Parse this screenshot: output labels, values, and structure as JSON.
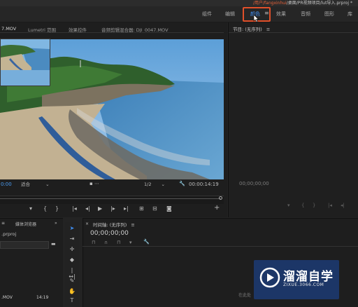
{
  "window": {
    "title_accent": "/用户/fangxinhui",
    "title_rest": "/桌面/PR视频项目/lut导入.prproj *"
  },
  "workspaces": [
    "组件",
    "编辑",
    "颜色",
    "效果",
    "音频",
    "图形",
    "库"
  ],
  "workspace_active": "颜色",
  "source_panel": {
    "tabs": [
      "7.MOV",
      "Lumetri 范围",
      "效果控件",
      "音频剪辑混合器: DJI_0047.MOV"
    ],
    "timecode_in": "0:00",
    "fit": "适合",
    "ratio": "1/2",
    "duration": "00:00:14:19"
  },
  "program_panel": {
    "title": "节目: (无序列)",
    "timecode": "00;00;00;00"
  },
  "project_panel": {
    "tab_title": "媒体浏览器",
    "file_name": ".prproj",
    "thumb_name": ".MOV",
    "thumb_duration": "14:19"
  },
  "timeline": {
    "title": "时间轴: (无序列)",
    "timecode": "00;00;00;00",
    "hint": "在此处"
  },
  "watermark": {
    "brand_cn": "溜溜自学",
    "brand_url": "ZIXUE.3066.COM"
  },
  "colors": {
    "accent_highlight": "#e0502a",
    "selected_tool": "#3e8df0",
    "timecode_blue": "#4a9bf0"
  }
}
